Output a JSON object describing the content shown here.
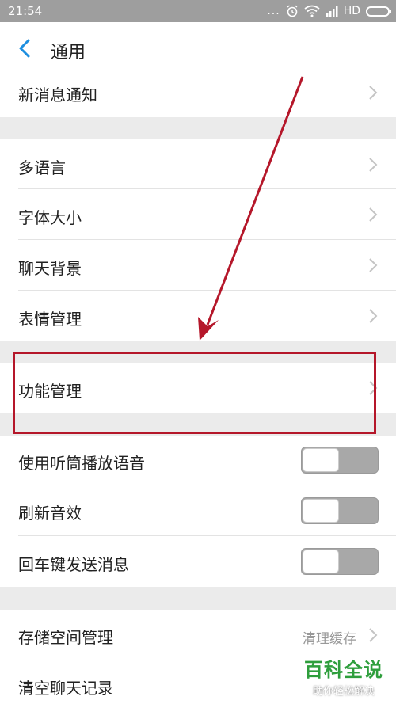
{
  "status_bar": {
    "time": "21:54",
    "dots": "...",
    "network": "HD"
  },
  "header": {
    "title": "通用"
  },
  "rows": {
    "new_message": {
      "label": "新消息通知"
    },
    "language": {
      "label": "多语言"
    },
    "font_size": {
      "label": "字体大小"
    },
    "chat_background": {
      "label": "聊天背景"
    },
    "sticker_manage": {
      "label": "表情管理"
    },
    "feature_manage": {
      "label": "功能管理"
    },
    "earpiece": {
      "label": "使用听筒播放语音",
      "on": false
    },
    "refresh_sound": {
      "label": "刷新音效",
      "on": false
    },
    "enter_send": {
      "label": "回车键发送消息",
      "on": false
    },
    "storage": {
      "label": "存储空间管理",
      "value": "清理缓存"
    },
    "clear_history": {
      "label": "清空聊天记录"
    }
  },
  "annotation": {
    "box_color": "#b5172a",
    "arrow_color": "#b5172a"
  },
  "watermark": {
    "title": "百科全说",
    "subtitle": "助你轻松解决"
  }
}
